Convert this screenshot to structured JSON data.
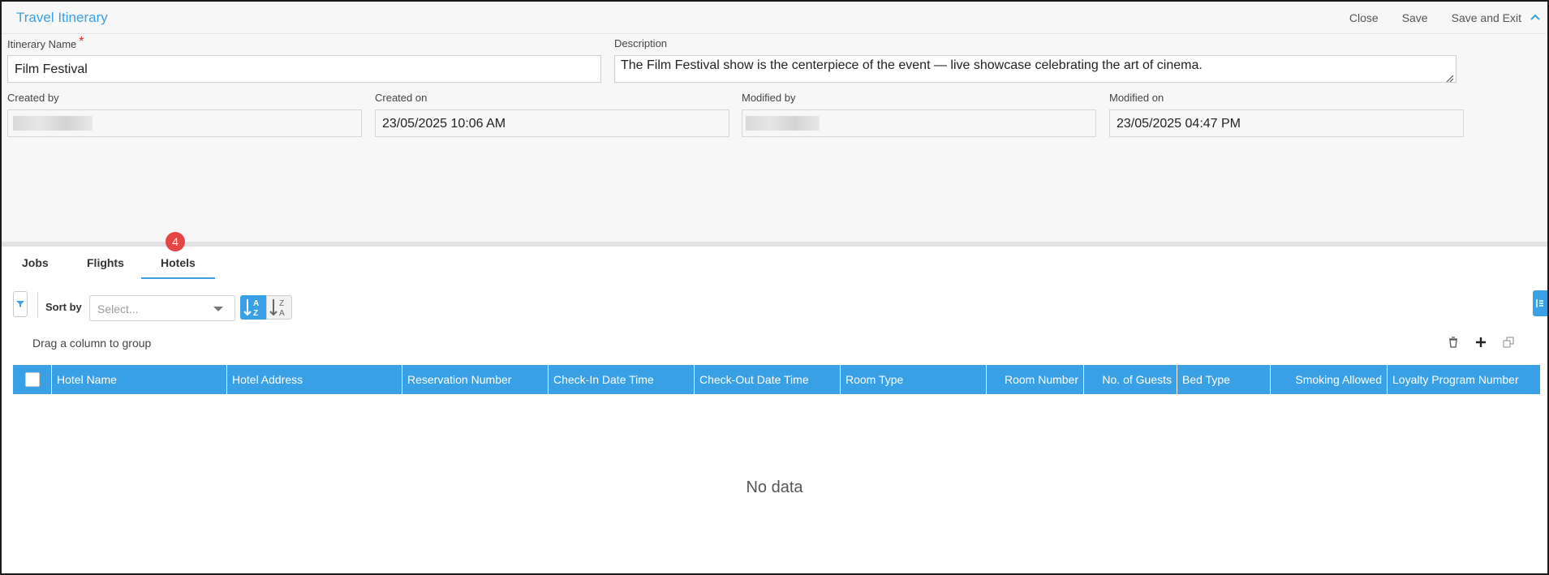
{
  "window": {
    "title": "Travel Itinerary"
  },
  "actions": {
    "close": "Close",
    "save": "Save",
    "save_exit": "Save and Exit"
  },
  "form": {
    "name_label": "Itinerary Name",
    "name_required": "*",
    "name_value": "Film Festival",
    "description_label": "Description",
    "description_value": "The Film Festival show is the centerpiece of the event — live showcase celebrating the art of cinema.",
    "created_by_label": "Created by",
    "created_on_label": "Created on",
    "created_on_value": "23/05/2025 10:06 AM",
    "modified_by_label": "Modified by",
    "modified_on_label": "Modified on",
    "modified_on_value": "23/05/2025 04:47 PM"
  },
  "tabs": [
    {
      "label": "Jobs"
    },
    {
      "label": "Flights"
    },
    {
      "label": "Hotels",
      "badge": "4",
      "active": true
    }
  ],
  "toolbar": {
    "sort_by_label": "Sort by",
    "sort_placeholder": "Select...",
    "group_hint": "Drag a column to group"
  },
  "table": {
    "columns": [
      "Hotel Name",
      "Hotel Address",
      "Reservation Number",
      "Check-In Date Time",
      "Check-Out Date Time",
      "Room Type",
      "Room Number",
      "No. of Guests",
      "Bed Type",
      "Smoking Allowed",
      "Loyalty Program Number"
    ],
    "empty_text": "No data"
  },
  "colors": {
    "accent": "#3aa0e6",
    "badge": "#e54545",
    "required": "#e02020"
  }
}
